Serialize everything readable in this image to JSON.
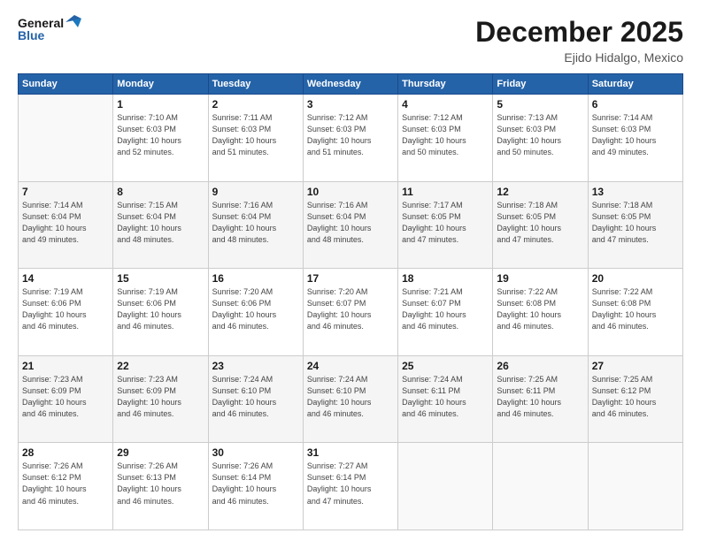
{
  "header": {
    "logo_line1": "General",
    "logo_line2": "Blue",
    "title": "December 2025",
    "location": "Ejido Hidalgo, Mexico"
  },
  "days_of_week": [
    "Sunday",
    "Monday",
    "Tuesday",
    "Wednesday",
    "Thursday",
    "Friday",
    "Saturday"
  ],
  "weeks": [
    [
      {
        "num": "",
        "info": ""
      },
      {
        "num": "1",
        "info": "Sunrise: 7:10 AM\nSunset: 6:03 PM\nDaylight: 10 hours\nand 52 minutes."
      },
      {
        "num": "2",
        "info": "Sunrise: 7:11 AM\nSunset: 6:03 PM\nDaylight: 10 hours\nand 51 minutes."
      },
      {
        "num": "3",
        "info": "Sunrise: 7:12 AM\nSunset: 6:03 PM\nDaylight: 10 hours\nand 51 minutes."
      },
      {
        "num": "4",
        "info": "Sunrise: 7:12 AM\nSunset: 6:03 PM\nDaylight: 10 hours\nand 50 minutes."
      },
      {
        "num": "5",
        "info": "Sunrise: 7:13 AM\nSunset: 6:03 PM\nDaylight: 10 hours\nand 50 minutes."
      },
      {
        "num": "6",
        "info": "Sunrise: 7:14 AM\nSunset: 6:03 PM\nDaylight: 10 hours\nand 49 minutes."
      }
    ],
    [
      {
        "num": "7",
        "info": "Sunrise: 7:14 AM\nSunset: 6:04 PM\nDaylight: 10 hours\nand 49 minutes."
      },
      {
        "num": "8",
        "info": "Sunrise: 7:15 AM\nSunset: 6:04 PM\nDaylight: 10 hours\nand 48 minutes."
      },
      {
        "num": "9",
        "info": "Sunrise: 7:16 AM\nSunset: 6:04 PM\nDaylight: 10 hours\nand 48 minutes."
      },
      {
        "num": "10",
        "info": "Sunrise: 7:16 AM\nSunset: 6:04 PM\nDaylight: 10 hours\nand 48 minutes."
      },
      {
        "num": "11",
        "info": "Sunrise: 7:17 AM\nSunset: 6:05 PM\nDaylight: 10 hours\nand 47 minutes."
      },
      {
        "num": "12",
        "info": "Sunrise: 7:18 AM\nSunset: 6:05 PM\nDaylight: 10 hours\nand 47 minutes."
      },
      {
        "num": "13",
        "info": "Sunrise: 7:18 AM\nSunset: 6:05 PM\nDaylight: 10 hours\nand 47 minutes."
      }
    ],
    [
      {
        "num": "14",
        "info": "Sunrise: 7:19 AM\nSunset: 6:06 PM\nDaylight: 10 hours\nand 46 minutes."
      },
      {
        "num": "15",
        "info": "Sunrise: 7:19 AM\nSunset: 6:06 PM\nDaylight: 10 hours\nand 46 minutes."
      },
      {
        "num": "16",
        "info": "Sunrise: 7:20 AM\nSunset: 6:06 PM\nDaylight: 10 hours\nand 46 minutes."
      },
      {
        "num": "17",
        "info": "Sunrise: 7:20 AM\nSunset: 6:07 PM\nDaylight: 10 hours\nand 46 minutes."
      },
      {
        "num": "18",
        "info": "Sunrise: 7:21 AM\nSunset: 6:07 PM\nDaylight: 10 hours\nand 46 minutes."
      },
      {
        "num": "19",
        "info": "Sunrise: 7:22 AM\nSunset: 6:08 PM\nDaylight: 10 hours\nand 46 minutes."
      },
      {
        "num": "20",
        "info": "Sunrise: 7:22 AM\nSunset: 6:08 PM\nDaylight: 10 hours\nand 46 minutes."
      }
    ],
    [
      {
        "num": "21",
        "info": "Sunrise: 7:23 AM\nSunset: 6:09 PM\nDaylight: 10 hours\nand 46 minutes."
      },
      {
        "num": "22",
        "info": "Sunrise: 7:23 AM\nSunset: 6:09 PM\nDaylight: 10 hours\nand 46 minutes."
      },
      {
        "num": "23",
        "info": "Sunrise: 7:24 AM\nSunset: 6:10 PM\nDaylight: 10 hours\nand 46 minutes."
      },
      {
        "num": "24",
        "info": "Sunrise: 7:24 AM\nSunset: 6:10 PM\nDaylight: 10 hours\nand 46 minutes."
      },
      {
        "num": "25",
        "info": "Sunrise: 7:24 AM\nSunset: 6:11 PM\nDaylight: 10 hours\nand 46 minutes."
      },
      {
        "num": "26",
        "info": "Sunrise: 7:25 AM\nSunset: 6:11 PM\nDaylight: 10 hours\nand 46 minutes."
      },
      {
        "num": "27",
        "info": "Sunrise: 7:25 AM\nSunset: 6:12 PM\nDaylight: 10 hours\nand 46 minutes."
      }
    ],
    [
      {
        "num": "28",
        "info": "Sunrise: 7:26 AM\nSunset: 6:12 PM\nDaylight: 10 hours\nand 46 minutes."
      },
      {
        "num": "29",
        "info": "Sunrise: 7:26 AM\nSunset: 6:13 PM\nDaylight: 10 hours\nand 46 minutes."
      },
      {
        "num": "30",
        "info": "Sunrise: 7:26 AM\nSunset: 6:14 PM\nDaylight: 10 hours\nand 46 minutes."
      },
      {
        "num": "31",
        "info": "Sunrise: 7:27 AM\nSunset: 6:14 PM\nDaylight: 10 hours\nand 47 minutes."
      },
      {
        "num": "",
        "info": ""
      },
      {
        "num": "",
        "info": ""
      },
      {
        "num": "",
        "info": ""
      }
    ]
  ]
}
